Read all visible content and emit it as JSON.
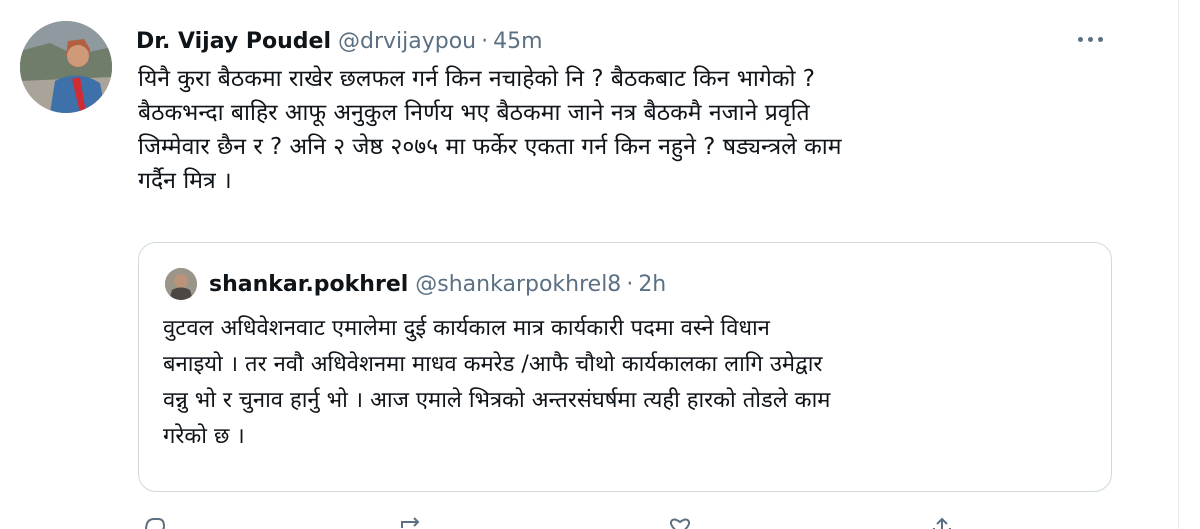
{
  "tweet": {
    "author_name": "Dr. Vijay Poudel",
    "author_handle": "@drvijaypou",
    "separator": "·",
    "time": "45m",
    "text": "यिनै कुरा बैठकमा राखेर छलफल गर्न किन नचाहेको नि ? बैठकबाट किन भागेको ?\nबैठकभन्दा बाहिर आफू अनुकुल निर्णय भए बैठकमा जाने नत्र बैठकमै नजाने प्रवृति\nजिम्मेवार छैन र ? अनि २ जेष्ठ २०७५ मा फर्केर एकता गर्न किन नहुने ? षड्यन्त्रले काम\nगर्दैन मित्र ।"
  },
  "quoted_tweet": {
    "author_name": "shankar.pokhrel",
    "author_handle": "@shankarpokhrel8",
    "separator": "·",
    "time": "2h",
    "text": "वुटवल अधिवेशनवाट एमालेमा दुई कार्यकाल मात्र कार्यकारी पदमा वस्ने विधान\nबनाइयो । तर नवौ अधिवेशनमा माधव कमरेड /आफै चौथो कार्यकालका लागि उमेद्वार\nवन्नु भो र चुनाव हार्नु भो । आज एमाले भित्रको अन्तरसंघर्षमा त्यही हारको तोडले काम\nगरेको छ ।"
  },
  "icons": {
    "more": "more-horizontal-icon",
    "reply": "reply-icon",
    "retweet": "retweet-icon",
    "like": "heart-icon",
    "share": "share-icon"
  },
  "colors": {
    "text_primary": "#0f1419",
    "text_secondary": "#5b7083",
    "border": "#cfd9de"
  }
}
